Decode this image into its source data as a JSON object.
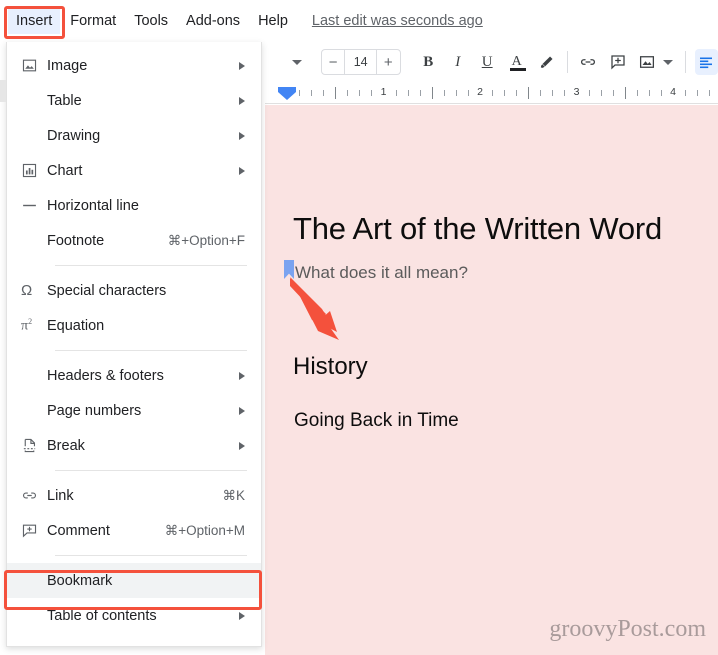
{
  "menubar": {
    "items": [
      {
        "label": "Insert",
        "active": true
      },
      {
        "label": "Format",
        "active": false
      },
      {
        "label": "Tools",
        "active": false
      },
      {
        "label": "Add-ons",
        "active": false
      },
      {
        "label": "Help",
        "active": false
      }
    ],
    "last_edit": "Last edit was seconds ago"
  },
  "toolbar": {
    "font_size_value": "14",
    "decrease_label": "−",
    "increase_label": "+",
    "bold_label": "B",
    "italic_label": "I",
    "underline_label": "U",
    "text_color_label": "A",
    "highlight_icon": "highlighter-icon",
    "link_icon": "link-icon",
    "comment_icon": "add-comment-icon",
    "image_icon": "insert-image-icon",
    "align_icon": "align-left-icon",
    "more_icon": "chevron-down-icon"
  },
  "ruler": {
    "numbers": [
      "1",
      "2",
      "3",
      "4"
    ]
  },
  "insert_menu": {
    "items": [
      {
        "icon": "image-icon",
        "label": "Image",
        "accel": "",
        "submenu": true,
        "highlighted": false
      },
      {
        "icon": "",
        "label": "Table",
        "accel": "",
        "submenu": true,
        "highlighted": false
      },
      {
        "icon": "",
        "label": "Drawing",
        "accel": "",
        "submenu": true,
        "highlighted": false
      },
      {
        "icon": "chart-icon",
        "label": "Chart",
        "accel": "",
        "submenu": true,
        "highlighted": false
      },
      {
        "icon": "horizontal-line-icon",
        "label": "Horizontal line",
        "accel": "",
        "submenu": false,
        "highlighted": false
      },
      {
        "icon": "",
        "label": "Footnote",
        "accel": "⌘+Option+F",
        "submenu": false,
        "highlighted": false
      },
      {
        "separator": true
      },
      {
        "icon": "omega-icon",
        "label": "Special characters",
        "accel": "",
        "submenu": false,
        "highlighted": false
      },
      {
        "icon": "equation-icon",
        "label": "Equation",
        "accel": "",
        "submenu": false,
        "highlighted": false
      },
      {
        "separator": true
      },
      {
        "icon": "",
        "label": "Headers & footers",
        "accel": "",
        "submenu": true,
        "highlighted": false
      },
      {
        "icon": "",
        "label": "Page numbers",
        "accel": "",
        "submenu": true,
        "highlighted": false
      },
      {
        "icon": "break-icon",
        "label": "Break",
        "accel": "",
        "submenu": true,
        "highlighted": false
      },
      {
        "separator": true
      },
      {
        "icon": "link-icon",
        "label": "Link",
        "accel": "⌘K",
        "submenu": false,
        "highlighted": false
      },
      {
        "icon": "comment-icon",
        "label": "Comment",
        "accel": "⌘+Option+M",
        "submenu": false,
        "highlighted": false
      },
      {
        "separator": true
      },
      {
        "icon": "",
        "label": "Bookmark",
        "accel": "",
        "submenu": false,
        "highlighted": true
      },
      {
        "icon": "",
        "label": "Table of contents",
        "accel": "",
        "submenu": true,
        "highlighted": false
      }
    ]
  },
  "document": {
    "title": "The Art of the Written Word",
    "subtitle": "What does it all mean?",
    "heading": "History",
    "paragraph": "Going Back in Time",
    "background_color": "#fae3e2"
  },
  "watermark": {
    "text": "groovyPost.com"
  },
  "annotations": {
    "highlight_color": "#f4513c",
    "insert_highlight": "Insert",
    "bookmark_highlight": "Bookmark",
    "arrow_color": "#f4513c",
    "bookmark_marker_color": "#7aa3f0"
  }
}
